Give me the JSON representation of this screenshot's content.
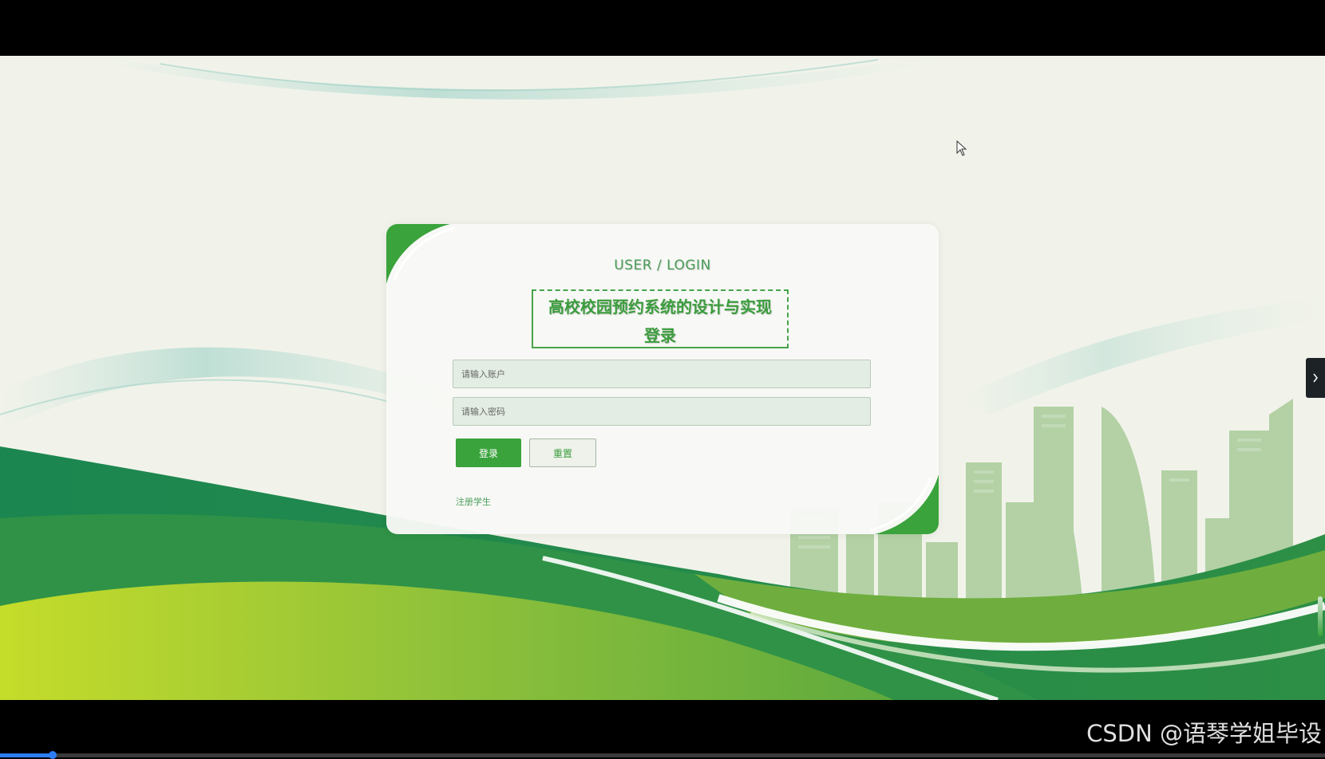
{
  "login": {
    "subtitle": "USER / LOGIN",
    "title_line1": "高校校园预约系统的设计与实现",
    "title_line2": "登录",
    "username_placeholder": "请输入账户",
    "password_placeholder": "请输入密码",
    "login_label": "登录",
    "reset_label": "重置",
    "register_label": "注册学生"
  },
  "watermark": "CSDN @语琴学姐毕设",
  "video": {
    "progress": 0.04
  },
  "colors": {
    "accent_green": "#3aa33c",
    "dark_green": "#1a8a4e",
    "light_green": "#9ccc3c",
    "page_background": "#f1f3ea"
  },
  "icons": {
    "side_handle": "chevron-right-icon",
    "cursor": "mouse-pointer-icon"
  }
}
